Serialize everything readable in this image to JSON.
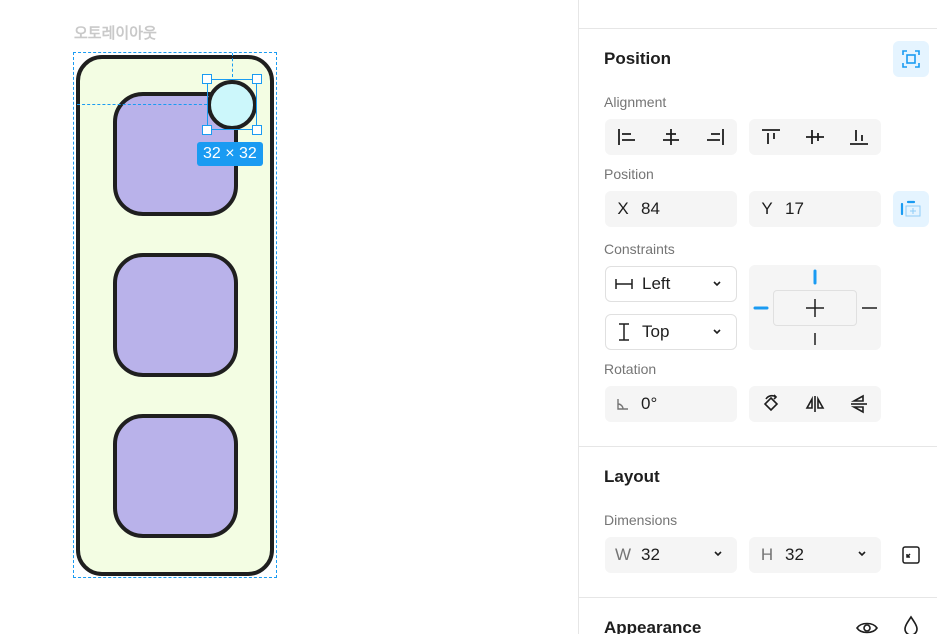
{
  "canvas": {
    "frame_label": "오토레이아웃",
    "size_badge": "32 × 32"
  },
  "panel": {
    "position": {
      "title": "Position",
      "alignment_label": "Alignment",
      "position_label": "Position",
      "x_label": "X",
      "x_value": "84",
      "y_label": "Y",
      "y_value": "17",
      "constraints_label": "Constraints",
      "horizontal_constraint": "Left",
      "vertical_constraint": "Top",
      "rotation_label": "Rotation",
      "rotation_value": "0°"
    },
    "layout": {
      "title": "Layout",
      "dimensions_label": "Dimensions",
      "w_label": "W",
      "w_value": "32",
      "h_label": "H",
      "h_value": "32"
    },
    "appearance": {
      "title": "Appearance"
    }
  },
  "colors": {
    "accent": "#1a9bf2",
    "frame_fill": "#f3fde3",
    "card_fill": "#b9b2ea",
    "circle_fill": "#ccf7fb",
    "stroke": "#1f1f1f"
  },
  "icons": [
    "align-left-icon",
    "align-center-h-icon",
    "align-right-icon",
    "align-top-icon",
    "align-center-v-icon",
    "align-bottom-icon",
    "absolute-position-icon",
    "horizontal-constraint-icon",
    "vertical-constraint-icon",
    "rotation-angle-icon",
    "rotate-icon",
    "flip-horizontal-icon",
    "flip-vertical-icon",
    "resize-to-fit-icon",
    "eye-icon",
    "drop-icon",
    "chevron-down-icon"
  ]
}
